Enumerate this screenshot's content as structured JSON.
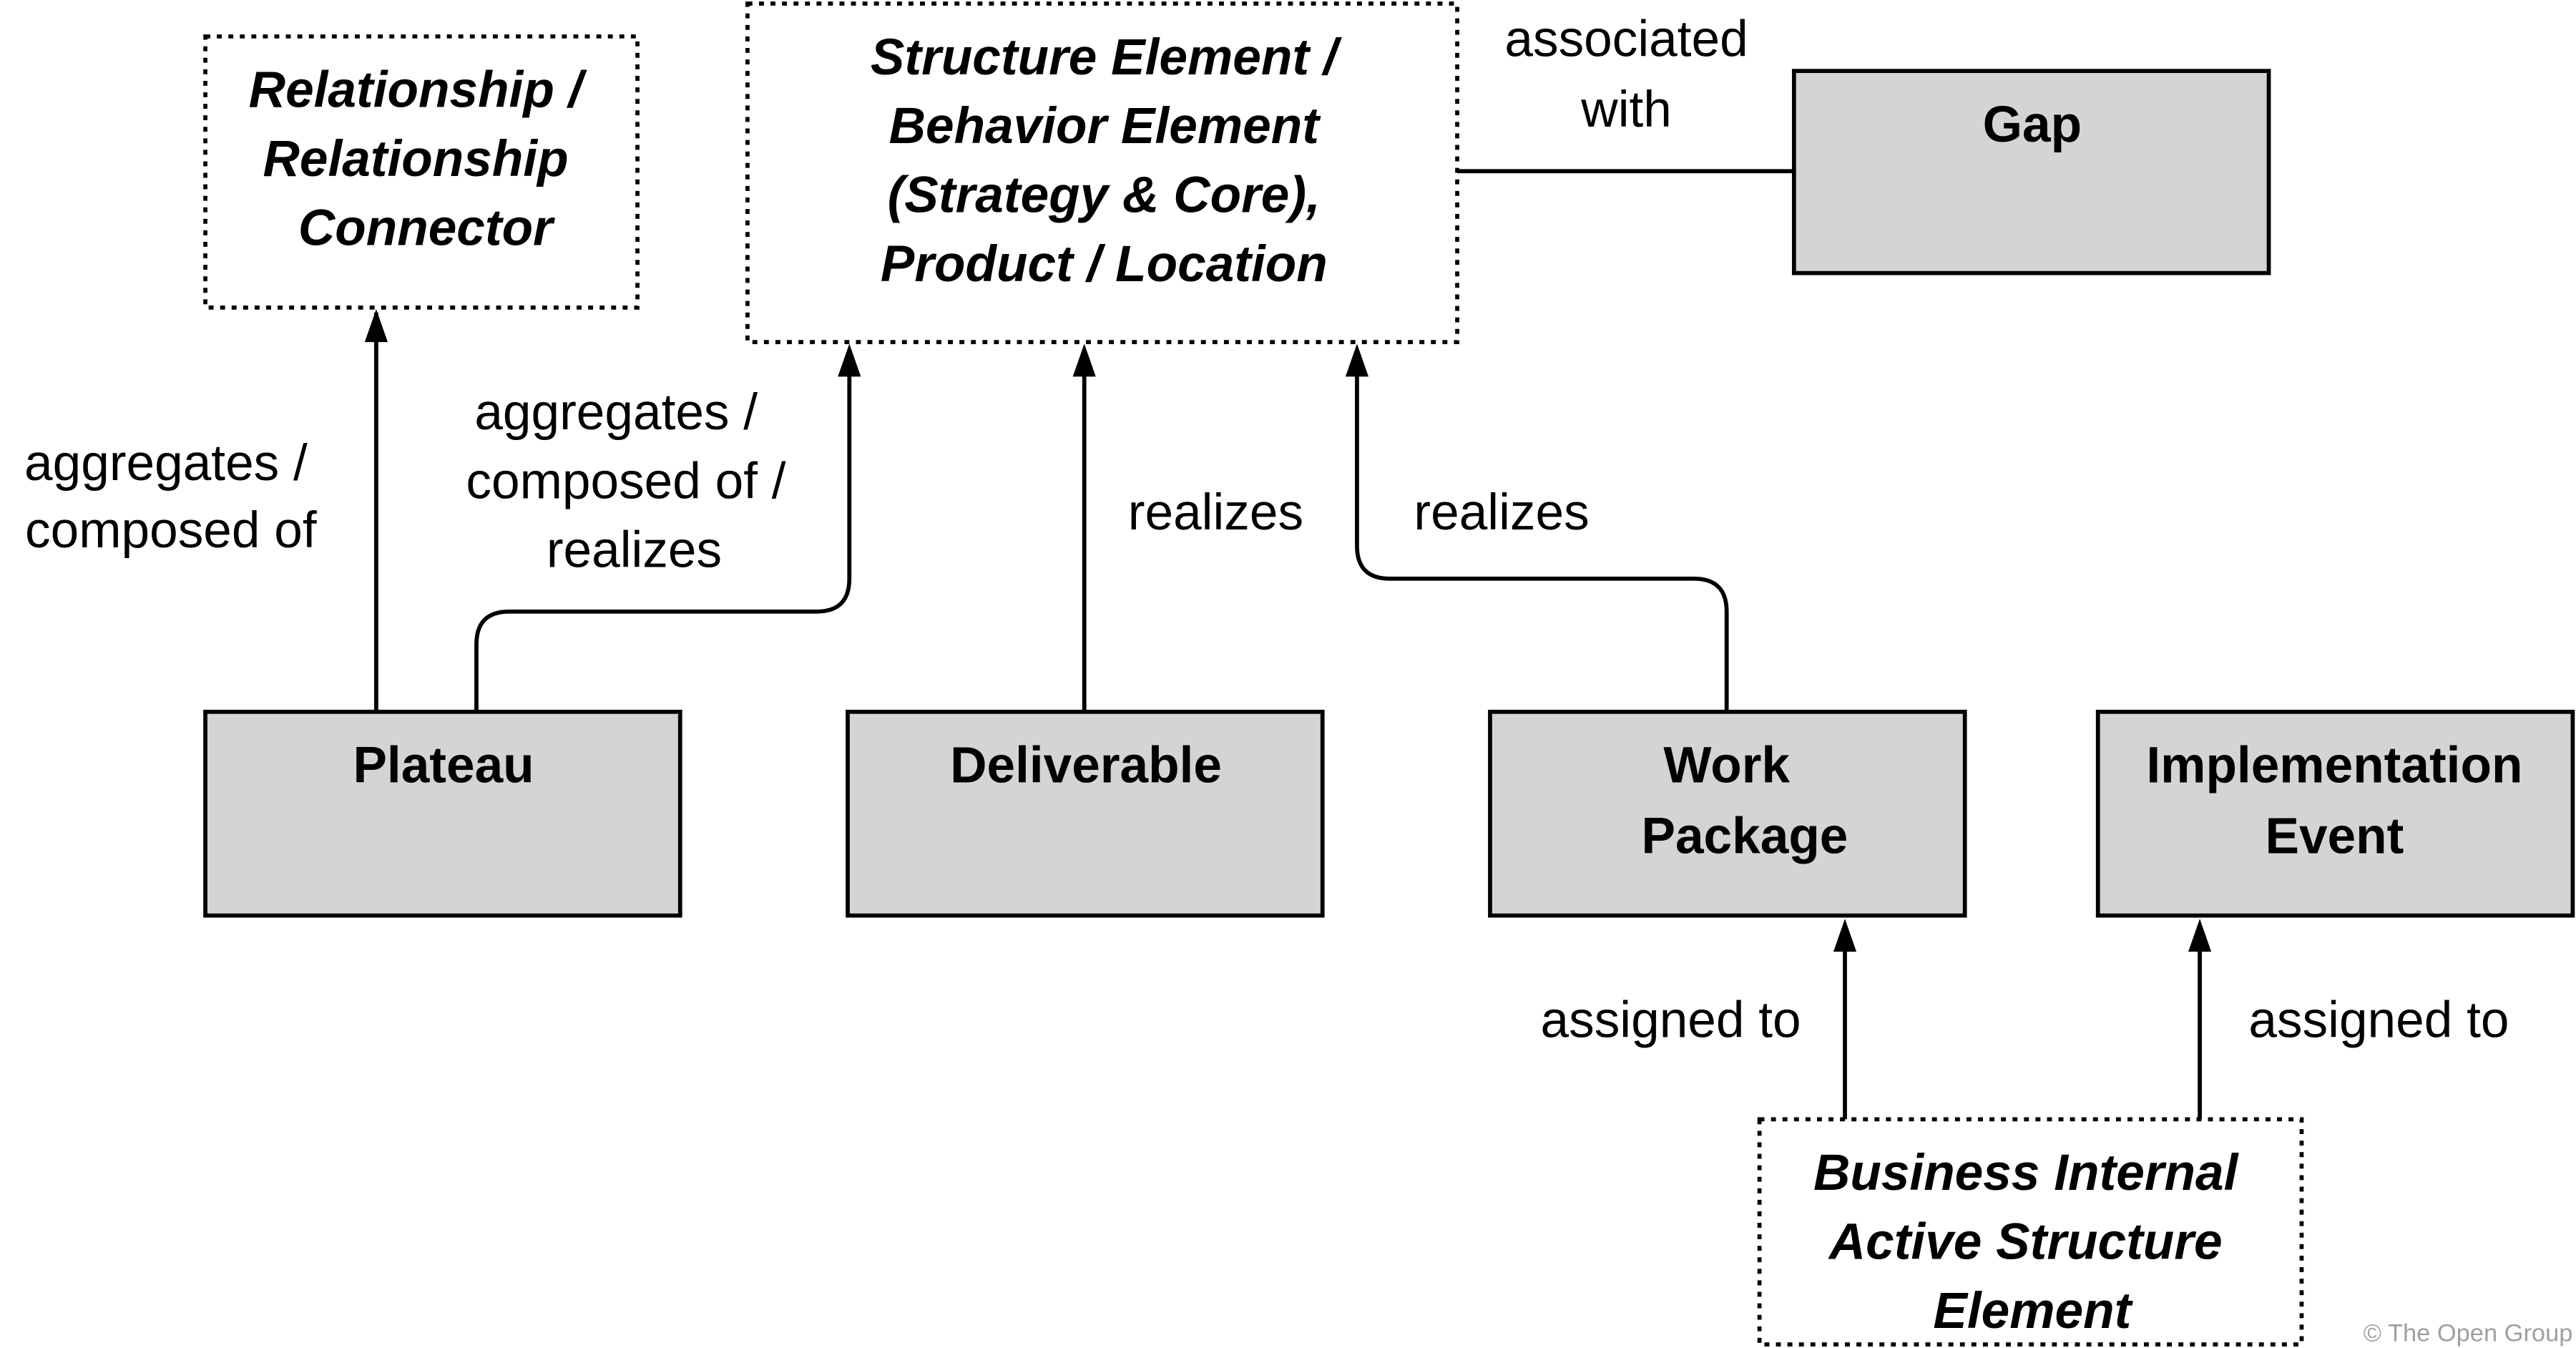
{
  "elements": {
    "relationship": {
      "lines": [
        "Relationship /",
        "Relationship",
        "Connector"
      ],
      "style": "dotted"
    },
    "structure": {
      "lines": [
        "Structure Element /",
        "Behavior Element",
        "(Strategy & Core),",
        "Product / Location"
      ],
      "style": "dotted"
    },
    "gap": {
      "lines": [
        "Gap"
      ],
      "fill": "#d4d4d4"
    },
    "plateau": {
      "lines": [
        "Plateau"
      ],
      "fill": "#d4d4d4"
    },
    "deliverable": {
      "lines": [
        "Deliverable"
      ],
      "fill": "#d4d4d4"
    },
    "work_package": {
      "lines": [
        "Work",
        "Package"
      ],
      "fill": "#d4d4d4"
    },
    "implementation_event": {
      "lines": [
        "Implementation",
        "Event"
      ],
      "fill": "#d4d4d4"
    },
    "business_internal": {
      "lines": [
        "Business Internal",
        "Active Structure",
        "Element"
      ],
      "style": "dotted"
    }
  },
  "relations": {
    "plateau_relationship": {
      "lines": [
        "aggregates /",
        "composed of"
      ]
    },
    "plateau_structure": {
      "lines": [
        "aggregates /",
        "composed of /",
        "realizes"
      ]
    },
    "deliverable_structure": {
      "lines": [
        "realizes"
      ]
    },
    "workpackage_structure": {
      "lines": [
        "realizes"
      ]
    },
    "gap_structure": {
      "lines": [
        "associated",
        "with"
      ]
    },
    "business_workpackage": {
      "lines": [
        "assigned to"
      ]
    },
    "business_event": {
      "lines": [
        "assigned to"
      ]
    }
  },
  "copyright": "© The Open Group"
}
